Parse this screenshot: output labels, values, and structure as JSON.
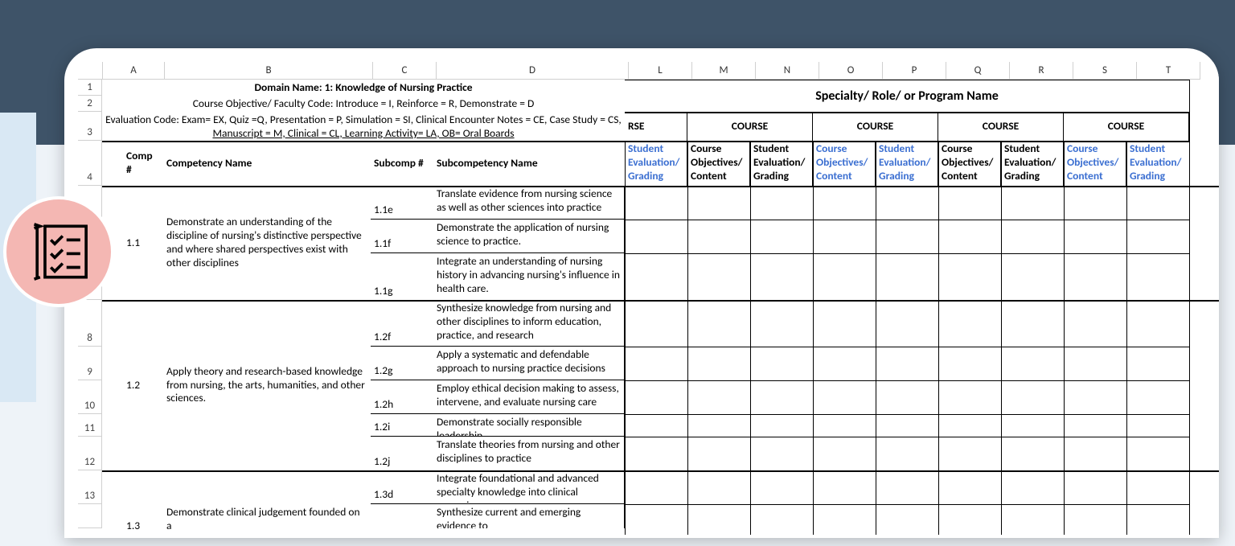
{
  "columns": [
    "A",
    "B",
    "C",
    "D",
    "L",
    "M",
    "N",
    "O",
    "P",
    "Q",
    "R",
    "S",
    "T"
  ],
  "row_numbers": {
    "r1": "1",
    "r2": "2",
    "r3": "3",
    "r4": "4",
    "r8": "8",
    "r9": "9",
    "r10": "10",
    "r11": "11",
    "r12": "12",
    "r13": "13"
  },
  "header": {
    "domain_name": "Domain Name:  1: Knowledge of Nursing Practice",
    "faculty_code": "Course Objective/ Faculty Code: Introduce = I, Reinforce = R, Demonstrate = D",
    "evaluation_code_line1": "Evaluation Code: Exam= EX, Quiz =Q, Presentation = P, Simulation = SI, Clinical Encounter Notes = CE, Case Study = CS,",
    "evaluation_code_line2": "Manuscript = M, Clinical = CL, Learning Activity= LA, OB= Oral Boards",
    "specialty_label": "Specialty/ Role/ or Program Name",
    "rse": "RSE",
    "course": "COURSE",
    "comp_num": "Comp #",
    "competency_name": "Competency Name",
    "subcomp_num": "Subcomp #",
    "subcomp_name": "Subcompetency Name",
    "course_objectives": "Course Objectives/ Content",
    "student_eval": "Student Evaluation/ Grading"
  },
  "rows": [
    {
      "comp": "1.1",
      "comp_name": "Demonstrate an understanding of the discipline of nursing's distinctive perspective and where shared perspectives exist with other disciplines",
      "subs": [
        {
          "code": "1.1e",
          "name": "Translate evidence from nursing science as well as other sciences into practice"
        },
        {
          "code": "1.1f",
          "name": "Demonstrate the application of nursing science to practice."
        },
        {
          "code": "1.1g",
          "name": "Integrate an understanding of nursing history in advancing nursing's influence in health care."
        }
      ]
    },
    {
      "comp": "1.2",
      "comp_name": "Apply theory and research-based knowledge from nursing, the arts, humanities, and other sciences.",
      "subs": [
        {
          "code": "1.2f",
          "name": " Synthesize knowledge from nursing and other disciplines to inform education, practice, and research"
        },
        {
          "code": "1.2g",
          "name": " Apply a systematic and defendable approach to nursing practice decisions"
        },
        {
          "code": "1.2h",
          "name": "Employ ethical decision making to assess, intervene, and evaluate nursing care"
        },
        {
          "code": "1.2i",
          "name": "Demonstrate socially responsible leadership"
        },
        {
          "code": "1.2j",
          "name": "Translate theories from nursing and other disciplines to practice"
        }
      ]
    },
    {
      "comp": "1.3",
      "comp_name": "Demonstrate clinical judgement founded on a",
      "subs": [
        {
          "code": "1.3d",
          "name": "Integrate foundational and advanced specialty knowledge into clinical reasoning."
        },
        {
          "code": "",
          "name": "Synthesize current and emerging evidence to"
        }
      ]
    }
  ]
}
